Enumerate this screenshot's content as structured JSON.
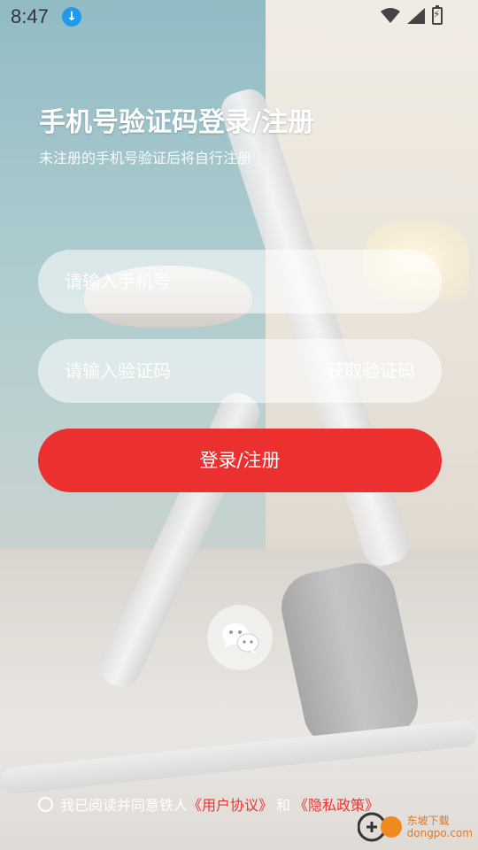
{
  "status_bar": {
    "time": "8:47",
    "download_icon": "download-icon",
    "wifi_icon": "wifi-icon",
    "signal_icon": "signal-icon",
    "battery_icon": "battery-charging-icon"
  },
  "header": {
    "title": "手机号验证码登录/注册",
    "subtitle": "未注册的手机号验证后将自行注册"
  },
  "form": {
    "phone_placeholder": "请输入手机号",
    "code_placeholder": "请输入验证码",
    "get_code_label": "获取验证码",
    "submit_label": "登录/注册"
  },
  "social": {
    "wechat_icon": "wechat-icon"
  },
  "agreement": {
    "prefix": "我已阅读并同意铁人",
    "user_agreement": "《用户协议》",
    "and": "和",
    "privacy_policy": "《隐私政策》"
  },
  "watermark": {
    "line1": "东坡下载",
    "line2": "dongpo.com"
  },
  "colors": {
    "accent": "#ec2f2f",
    "link": "#ee3333",
    "title": "#ffffff"
  }
}
